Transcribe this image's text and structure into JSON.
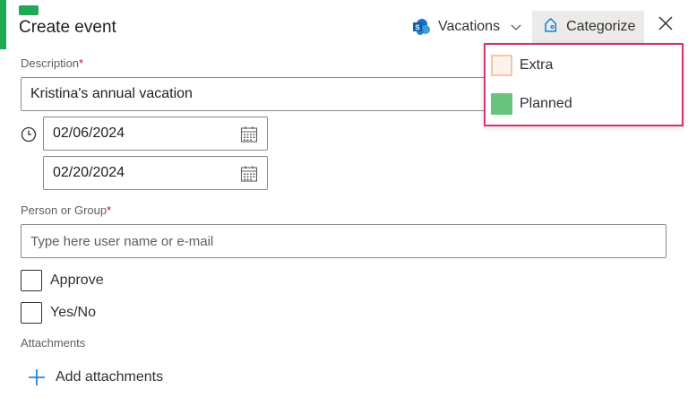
{
  "header": {
    "title": "Create event",
    "calendar": {
      "label": "Vacations",
      "icon": "sharepoint-icon"
    },
    "categorize_label": "Categorize",
    "close_icon": "close-icon"
  },
  "form": {
    "description": {
      "label": "Description",
      "required_mark": "*",
      "value": "Kristina's annual vacation"
    },
    "dates": {
      "start": "02/06/2024",
      "end": "02/20/2024",
      "icon": "calendar-icon",
      "time_icon": "clock-icon"
    },
    "person": {
      "label": "Person or Group",
      "required_mark": "*",
      "placeholder": "Type here user name or e-mail"
    },
    "approve_label": "Approve",
    "yesno_label": "Yes/No",
    "attachments": {
      "label": "Attachments",
      "add_label": "Add attachments",
      "icon": "plus-icon"
    }
  },
  "category_menu": {
    "items": [
      {
        "label": "Extra",
        "color": "#fde9d9",
        "border": "#f4c6a5"
      },
      {
        "label": "Planned",
        "color": "#6ac27f",
        "border": "#6ac27f"
      }
    ],
    "highlight_color": "#d6336c"
  },
  "colors": {
    "accent": "#1fa855",
    "link_blue": "#0078d4"
  }
}
